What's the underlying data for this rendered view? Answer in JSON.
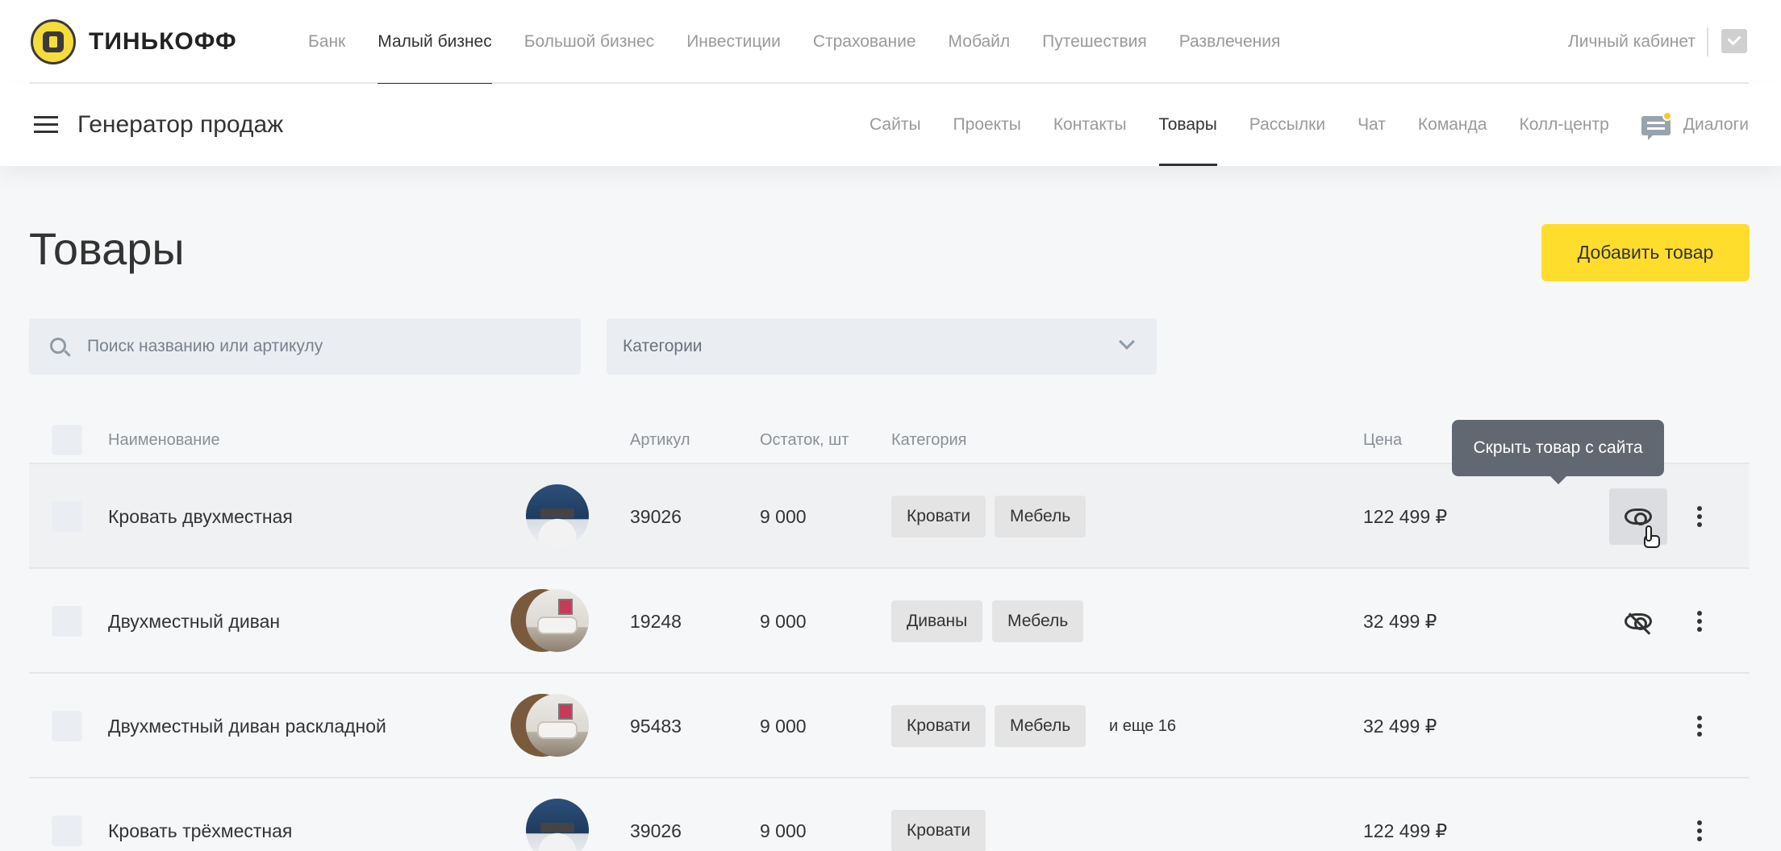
{
  "brand": {
    "name": "ТИНЬКОФФ"
  },
  "top_nav": {
    "items": [
      "Банк",
      "Малый бизнес",
      "Большой бизнес",
      "Инвестиции",
      "Страхование",
      "Мобайл",
      "Путешествия",
      "Развлечения"
    ],
    "active_index": 1,
    "cabinet_label": "Личный кабинет"
  },
  "sub_nav": {
    "product_title": "Генератор продаж",
    "items": [
      "Сайты",
      "Проекты",
      "Контакты",
      "Товары",
      "Рассылки",
      "Чат",
      "Команда",
      "Колл-центр"
    ],
    "active_index": 3,
    "dialogs_label": "Диалоги"
  },
  "page": {
    "title": "Товары",
    "add_button": "Добавить товар",
    "search_placeholder": "Поиск названию или артикулу",
    "categories_placeholder": "Категории"
  },
  "table": {
    "headers": {
      "name": "Наименование",
      "sku": "Артикул",
      "stock": "Остаток, шт",
      "category": "Категория",
      "price": "Цена"
    },
    "rows": [
      {
        "name": "Кровать двухместная",
        "image": "bed",
        "sku": "39026",
        "stock": "9 000",
        "tags": [
          "Кровати",
          "Мебель"
        ],
        "more": "",
        "price": "122 499 ₽",
        "visibility": "visible"
      },
      {
        "name": "Двухместный диван",
        "image": "sofa",
        "sku": "19248",
        "stock": "9 000",
        "tags": [
          "Диваны",
          "Мебель"
        ],
        "more": "",
        "price": "32 499 ₽",
        "visibility": "hidden"
      },
      {
        "name": "Двухместный диван раскладной",
        "image": "sofa",
        "sku": "95483",
        "stock": "9 000",
        "tags": [
          "Кровати",
          "Мебель"
        ],
        "more": "и еще 16",
        "price": "32 499 ₽",
        "visibility": "none"
      },
      {
        "name": "Кровать трёхместная",
        "image": "bed",
        "sku": "39026",
        "stock": "9 000",
        "tags": [
          "Кровати"
        ],
        "more": "",
        "price": "122 499 ₽",
        "visibility": "none"
      }
    ]
  },
  "tooltip": {
    "text": "Скрыть товар с сайта"
  },
  "colors": {
    "accent": "#ffdd2d",
    "input_bg": "#eaeef3",
    "tooltip_bg": "#616872"
  }
}
